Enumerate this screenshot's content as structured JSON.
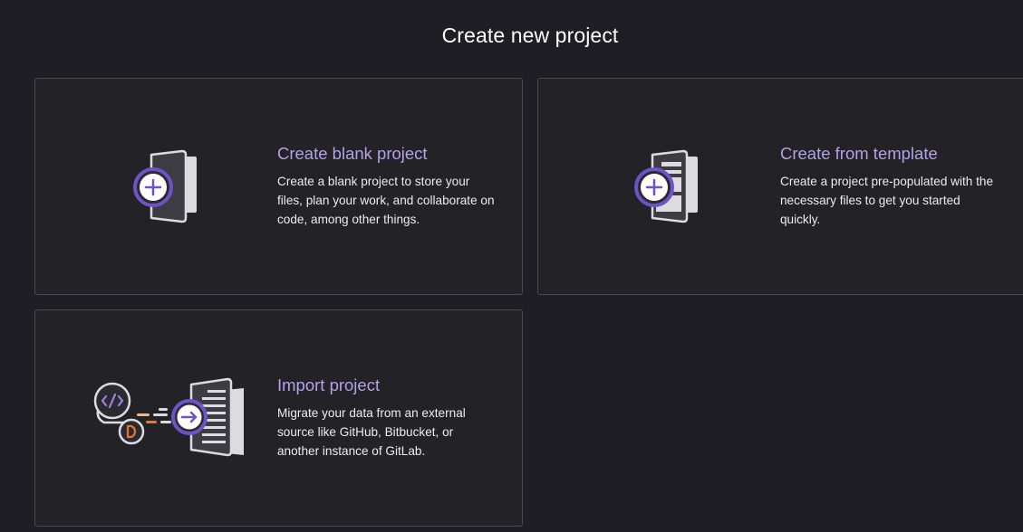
{
  "page": {
    "title": "Create new project"
  },
  "cards": [
    {
      "id": "blank",
      "heading": "Create blank project",
      "description": "Create a blank project to store your files, plan your work, and collaborate on code, among other things.",
      "illustration": "blank-project-illustration"
    },
    {
      "id": "template",
      "heading": "Create from template",
      "description": "Create a project pre-populated with the necessary files to get you started quickly.",
      "illustration": "template-project-illustration"
    },
    {
      "id": "import",
      "heading": "Import project",
      "description": "Migrate your data from an external source like GitHub, Bitbucket, or another instance of GitLab.",
      "illustration": "import-project-illustration"
    }
  ],
  "colors": {
    "background": "#1f1e24",
    "card_background": "#232227",
    "card_border": "#4a4950",
    "accent_purple": "#b3a2e6",
    "badge_purple": "#6f52c7",
    "accent_orange": "#e2763a"
  }
}
